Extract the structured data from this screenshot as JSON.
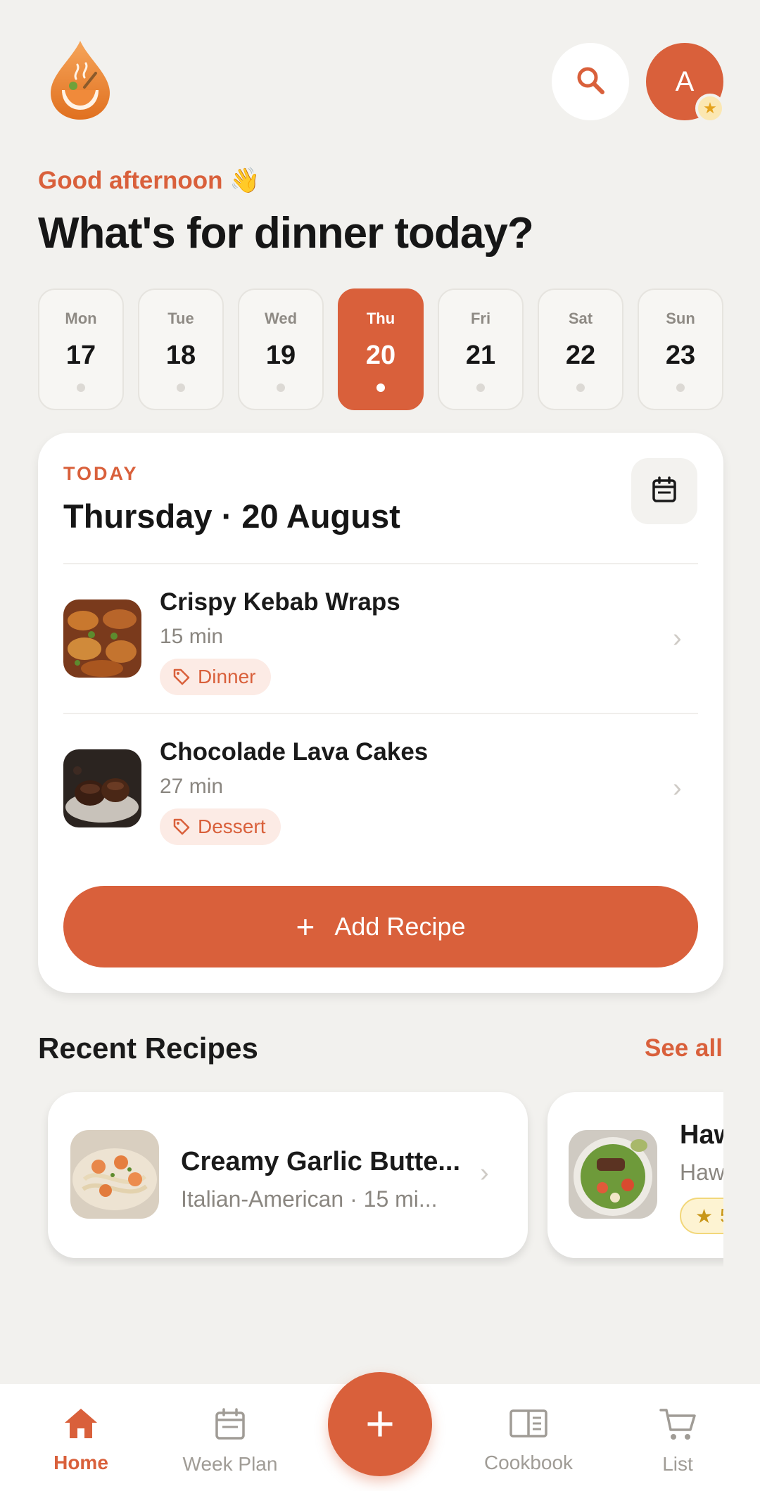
{
  "header": {
    "greeting": "Good afternoon 👋",
    "headline": "What's for dinner today?",
    "avatar_initial": "A"
  },
  "days": [
    {
      "name": "Mon",
      "date": "17",
      "active": false
    },
    {
      "name": "Tue",
      "date": "18",
      "active": false
    },
    {
      "name": "Wed",
      "date": "19",
      "active": false
    },
    {
      "name": "Thu",
      "date": "20",
      "active": true
    },
    {
      "name": "Fri",
      "date": "21",
      "active": false
    },
    {
      "name": "Sat",
      "date": "22",
      "active": false
    },
    {
      "name": "Sun",
      "date": "23",
      "active": false
    }
  ],
  "today": {
    "label": "TODAY",
    "date": "Thursday · 20 August",
    "recipes": [
      {
        "title": "Crispy Kebab Wraps",
        "time": "15 min",
        "tag": "Dinner"
      },
      {
        "title": "Chocolade Lava Cakes",
        "time": "27 min",
        "tag": "Dessert"
      }
    ],
    "add_label": "Add Recipe"
  },
  "recent": {
    "title": "Recent Recipes",
    "see_all": "See all",
    "items": [
      {
        "title": "Creamy Garlic Butte...",
        "subtitle": "Italian-American · 15 mi..."
      },
      {
        "title": "Haw",
        "subtitle": "Haw",
        "rating": "5"
      }
    ]
  },
  "nav": {
    "home": "Home",
    "week_plan": "Week Plan",
    "cookbook": "Cookbook",
    "list": "List"
  },
  "colors": {
    "accent": "#D9603B",
    "background": "#F2F1EE",
    "tag_bg": "#FCEBE5"
  }
}
